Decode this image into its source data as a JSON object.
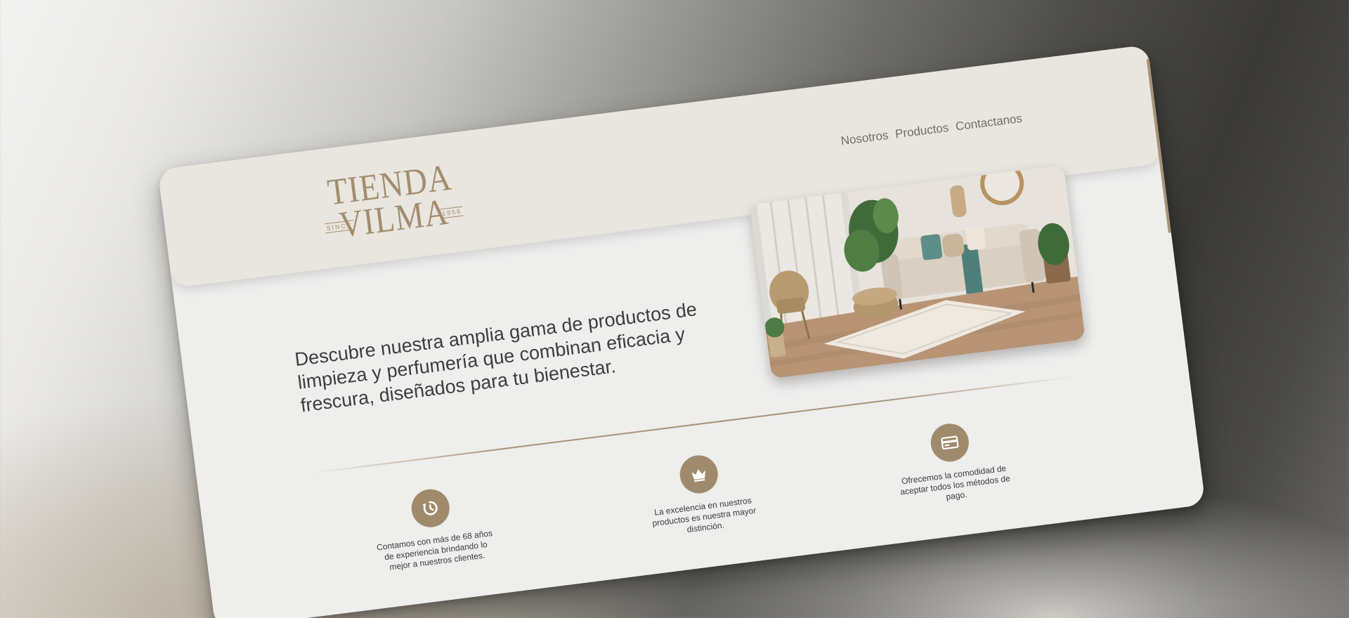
{
  "brand": {
    "logo_top": "TIENDA",
    "logo_bottom": "VILMA",
    "logo_since": "SINCE",
    "logo_year": "1956"
  },
  "nav": {
    "items": [
      "Nosotros",
      "Productos",
      "Contactanos"
    ]
  },
  "hero": {
    "text": "Descubre nuestra amplia gama de productos de limpieza y perfumería que combinan eficacia y frescura, diseñados para tu bienestar."
  },
  "features": [
    {
      "icon": "history-icon",
      "text": "Contamos con más de 68 años de experiencia brindando lo mejor a nuestros clientes."
    },
    {
      "icon": "crown-icon",
      "text": "La excelencia en nuestros productos es nuestra mayor distinción."
    },
    {
      "icon": "credit-card-icon",
      "text": "Ofrecemos la comodidad de aceptar todos los métodos de pago."
    }
  ],
  "colors": {
    "accent": "#a08a6c",
    "header_bg": "#e9e6e0",
    "card_bg": "#eeeeed"
  }
}
